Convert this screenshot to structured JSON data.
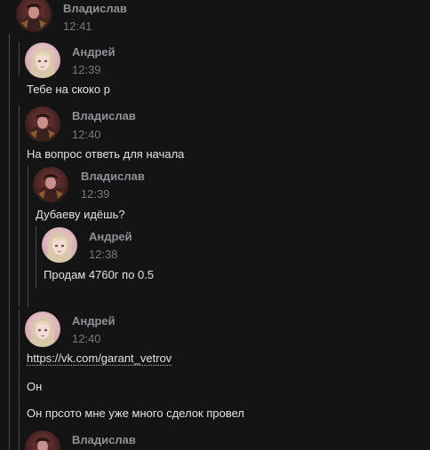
{
  "thread": {
    "root": {
      "author": "Владислав",
      "time": "12:41"
    },
    "quote_andrey_1": {
      "author": "Андрей",
      "time": "12:39",
      "text": "Тебе на скоко р"
    },
    "quote_vlad_2": {
      "author": "Владислав",
      "time": "12:40",
      "text": "На вопрос ответь для начала"
    },
    "quote_vlad_3": {
      "author": "Владислав",
      "time": "12:39",
      "text": "Дубаеву идёшь?"
    },
    "quote_andrey_4": {
      "author": "Андрей",
      "time": "12:38",
      "text": "Продам 4760г по 0.5"
    },
    "quote_andrey_5": {
      "author": "Андрей",
      "time": "12:40",
      "link": "https://vk.com/garant_vetrov",
      "line2": "Он",
      "line3": "Он прсото мне уже много сделок провел"
    },
    "quote_vlad_6": {
      "author": "Владислав"
    }
  },
  "colors": {
    "background": "#141414",
    "author": "#8f9196",
    "time": "#76787d",
    "text": "#e1e3e6",
    "quote_line": "#4a4a4a"
  },
  "icons": {
    "vlad_avatar": "dark-warrior-avatar",
    "andrey_avatar": "blonde-girl-avatar"
  }
}
